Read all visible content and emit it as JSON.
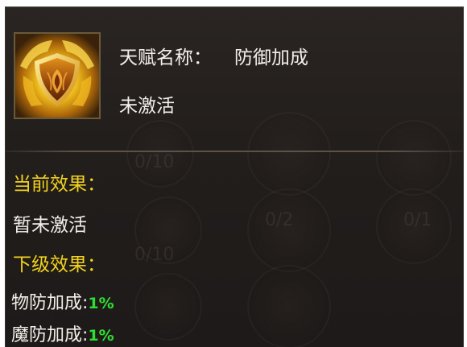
{
  "talent": {
    "name_label": "天赋名称：",
    "name_value": "防御加成",
    "status": "未激活",
    "icon": "shield-buff-icon"
  },
  "current_effect": {
    "heading": "当前效果：",
    "text": "暂未激活"
  },
  "next_effect": {
    "heading": "下级效果：",
    "stats": [
      {
        "label": "物防加成:",
        "value": "1%"
      },
      {
        "label": "魔防加成:",
        "value": "1%"
      }
    ]
  },
  "background_counters": [
    "0/10",
    "0/2",
    "0/1",
    "0/10"
  ],
  "colors": {
    "heading": "#f2d21c",
    "text": "#f2efea",
    "value": "#2ee02e",
    "panel": "#221e1c"
  }
}
